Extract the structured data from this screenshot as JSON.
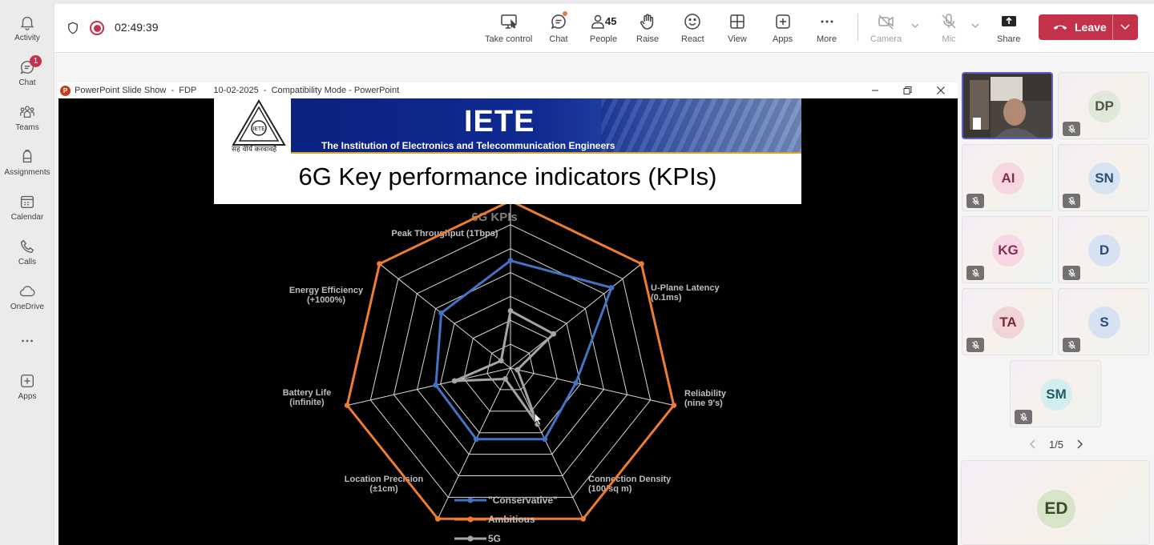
{
  "rail": {
    "items": [
      {
        "label": "Activity",
        "icon": "bell-icon"
      },
      {
        "label": "Chat",
        "icon": "chat-icon",
        "badge": "1"
      },
      {
        "label": "Teams",
        "icon": "teams-icon"
      },
      {
        "label": "Assignments",
        "icon": "assignments-icon"
      },
      {
        "label": "Calendar",
        "icon": "calendar-icon"
      },
      {
        "label": "Calls",
        "icon": "phone-icon"
      },
      {
        "label": "OneDrive",
        "icon": "cloud-icon"
      },
      {
        "label": "",
        "icon": "more-icon"
      },
      {
        "label": "Apps",
        "icon": "add-apps-icon"
      }
    ]
  },
  "meeting": {
    "timer": "02:49:39",
    "toolbar": {
      "take_control": "Take control",
      "chat": "Chat",
      "people": "People",
      "people_count": "45",
      "raise": "Raise",
      "react": "React",
      "view": "View",
      "apps": "Apps",
      "more": "More",
      "camera": "Camera",
      "mic": "Mic",
      "share": "Share",
      "leave": "Leave"
    }
  },
  "shared_window": {
    "title": "PowerPoint Slide Show  -  FDP       10-02-2025  -  Compatibility Mode - PowerPoint",
    "slide": {
      "banner_title": "IETE",
      "banner_subtitle": "The Institution of Electronics and Telecommunication Engineers",
      "banner_motto": "सह वीर्यं करवावहै",
      "title": "6G Key performance indicators (KPIs)"
    }
  },
  "chart_data": {
    "type": "radar",
    "title": "6G KPIs",
    "axes": [
      {
        "label": "Peak Throughput (1Tbps)",
        "lines": [
          "Peak Throughput (1Tbps)"
        ]
      },
      {
        "label": "U-Plane Latency (0.1ms)",
        "lines": [
          "U-Plane Latency",
          "(0.1ms)"
        ]
      },
      {
        "label": "Reliability (nine 9's)",
        "lines": [
          "Reliability",
          "(nine 9's)"
        ]
      },
      {
        "label": "Connection Density (100/sq m)",
        "lines": [
          "Connection Density",
          "(100/sq m)"
        ]
      },
      {
        "label": "Location Precision (±1cm)",
        "lines": [
          "Location Precision",
          "(±1cm)"
        ]
      },
      {
        "label": "Battery Life (infinite)",
        "lines": [
          "Battery Life",
          "(infinite)"
        ]
      },
      {
        "label": "Energy Efficiency (+1000%)",
        "lines": [
          "Energy Efficiency",
          "(+1000%)"
        ]
      }
    ],
    "scale_max": 7,
    "grid": true,
    "legend": "bottom",
    "series": [
      {
        "name": "\"Conservative\"",
        "color": "#4472c4",
        "values": [
          4.5,
          5.4,
          2.8,
          3.3,
          3.3,
          3.2,
          3.7
        ]
      },
      {
        "name": "Ambitious",
        "color": "#ed7d31",
        "values": [
          7,
          7,
          7,
          7,
          7,
          7,
          7
        ]
      },
      {
        "name": "5G",
        "color": "#a5a5a5",
        "values": [
          2.4,
          2.3,
          0.3,
          2.6,
          0.5,
          2.4,
          0.5
        ]
      }
    ]
  },
  "participants": {
    "tiles": [
      {
        "initials": "",
        "video": true
      },
      {
        "initials": "DP",
        "bg": "#e2e7dc",
        "fg": "#4d5a43"
      },
      {
        "initials": "AI",
        "bg": "#f6d7e0",
        "fg": "#8a2a4a"
      },
      {
        "initials": "SN",
        "bg": "#d6e4f2",
        "fg": "#2c4e73"
      },
      {
        "initials": "KG",
        "bg": "#f6d7e3",
        "fg": "#8a2a55"
      },
      {
        "initials": "D",
        "bg": "#d6e2f3",
        "fg": "#2c4a7a"
      },
      {
        "initials": "TA",
        "bg": "#f0d4d7",
        "fg": "#7a2a35"
      },
      {
        "initials": "S",
        "bg": "#d6e2f3",
        "fg": "#2c4a7a"
      },
      {
        "initials": "SM",
        "bg": "#d4eef0",
        "fg": "#1f5c63"
      }
    ],
    "page": "1/5",
    "spotlight_initials": "ED"
  }
}
